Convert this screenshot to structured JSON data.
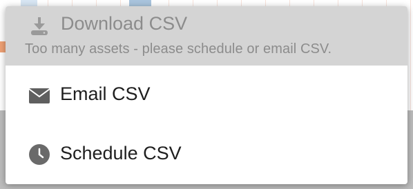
{
  "menu": {
    "download": {
      "label": "Download CSV",
      "hint": "Too many assets - please schedule or email CSV.",
      "icon": "download-icon",
      "disabled": true
    },
    "email": {
      "label": "Email CSV",
      "icon": "envelope-icon"
    },
    "schedule": {
      "label": "Schedule CSV",
      "icon": "clock-icon"
    }
  },
  "colors": {
    "disabled_bg": "#d4d4d4",
    "disabled_text": "#8c8c8c",
    "text": "#1e1e1e",
    "icon": "#5f5f5f"
  }
}
